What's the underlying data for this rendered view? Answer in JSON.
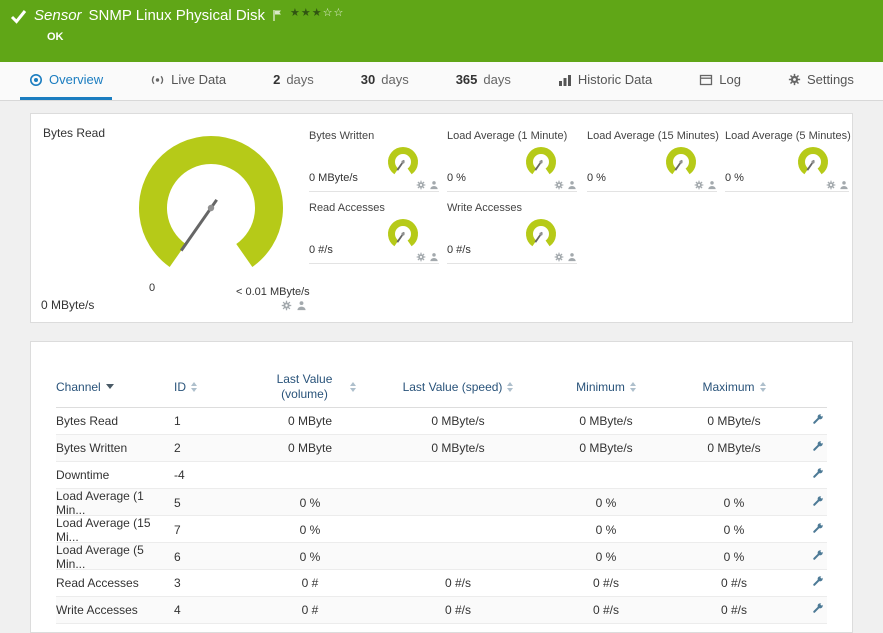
{
  "colors": {
    "status_ok_green": "#60a617",
    "gauge_lime": "#b6ca18",
    "active_tab_blue": "#1b7dc0",
    "row_icon_blue_gray": "#4d7a96"
  },
  "header": {
    "sensor_label": "Sensor",
    "sensor_name": "SNMP Linux Physical Disk",
    "status": "OK",
    "rating_filled": "★★★",
    "rating_empty": "☆☆"
  },
  "tabs": [
    {
      "label": "Overview",
      "icon": "overview-icon",
      "active": true
    },
    {
      "label": "Live Data",
      "icon": "live-data-icon"
    },
    {
      "num": "2",
      "label": "days"
    },
    {
      "num": "30",
      "label": "days"
    },
    {
      "num": "365",
      "label": "days"
    },
    {
      "label": "Historic Data",
      "icon": "historic-data-icon"
    },
    {
      "label": "Log",
      "icon": "log-icon"
    },
    {
      "label": "Settings",
      "icon": "settings-gear-icon"
    }
  ],
  "gauges": {
    "big": {
      "title": "Bytes Read",
      "value": "0 MByte/s",
      "scale_min": "0",
      "scale_max": "< 0.01 MByte/s"
    },
    "small": [
      {
        "title": "Bytes Written",
        "value": "0 MByte/s"
      },
      {
        "title": "Load Average (1 Minute)",
        "value": "0 %"
      },
      {
        "title": "Load Average (15 Minutes)",
        "value": "0 %"
      },
      {
        "title": "Load Average (5 Minutes)",
        "value": "0 %"
      },
      {
        "title": "Read Accesses",
        "value": "0 #/s"
      },
      {
        "title": "Write Accesses",
        "value": "0 #/s"
      }
    ]
  },
  "table": {
    "headers": {
      "channel": "Channel",
      "id": "ID",
      "last_volume": "Last Value (volume)",
      "last_speed": "Last Value (speed)",
      "min": "Minimum",
      "max": "Maximum"
    },
    "rows": [
      {
        "channel": "Bytes Read",
        "id": "1",
        "last_volume": "0 MByte",
        "last_speed": "0 MByte/s",
        "min": "0 MByte/s",
        "max": "0 MByte/s"
      },
      {
        "channel": "Bytes Written",
        "id": "2",
        "last_volume": "0 MByte",
        "last_speed": "0 MByte/s",
        "min": "0 MByte/s",
        "max": "0 MByte/s"
      },
      {
        "channel": "Downtime",
        "id": "-4",
        "last_volume": "",
        "last_speed": "",
        "min": "",
        "max": ""
      },
      {
        "channel": "Load Average (1 Min...",
        "id": "5",
        "last_volume": "0 %",
        "last_speed": "",
        "min": "0 %",
        "max": "0 %"
      },
      {
        "channel": "Load Average (15 Mi...",
        "id": "7",
        "last_volume": "0 %",
        "last_speed": "",
        "min": "0 %",
        "max": "0 %"
      },
      {
        "channel": "Load Average (5 Min...",
        "id": "6",
        "last_volume": "0 %",
        "last_speed": "",
        "min": "0 %",
        "max": "0 %"
      },
      {
        "channel": "Read Accesses",
        "id": "3",
        "last_volume": "0 #",
        "last_speed": "0 #/s",
        "min": "0 #/s",
        "max": "0 #/s"
      },
      {
        "channel": "Write Accesses",
        "id": "4",
        "last_volume": "0 #",
        "last_speed": "0 #/s",
        "min": "0 #/s",
        "max": "0 #/s"
      }
    ]
  }
}
